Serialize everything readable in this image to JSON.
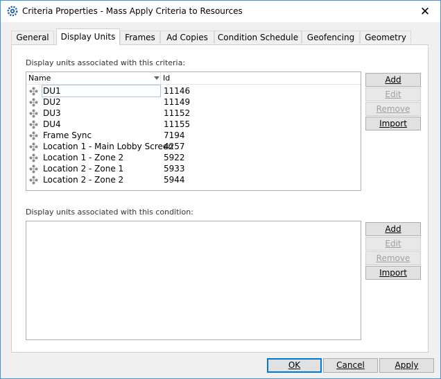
{
  "window": {
    "title": "Criteria Properties - Mass Apply Criteria to Resources",
    "close_glyph": "✕",
    "accent": "#1e5fb4"
  },
  "tabs": [
    {
      "label": "General"
    },
    {
      "label": "Display Units",
      "active": true
    },
    {
      "label": "Frames"
    },
    {
      "label": "Ad Copies"
    },
    {
      "label": "Condition Schedule"
    },
    {
      "label": "Geofencing"
    },
    {
      "label": "Geometry"
    }
  ],
  "criteria_section": {
    "label": "Display units associated with this criteria:",
    "columns": {
      "name": "Name",
      "id": "Id"
    },
    "rows": [
      {
        "name": "DU1",
        "id": "11146"
      },
      {
        "name": "DU2",
        "id": "11149"
      },
      {
        "name": "DU3",
        "id": "11152"
      },
      {
        "name": "DU4",
        "id": "11155"
      },
      {
        "name": "Frame Sync",
        "id": "7194"
      },
      {
        "name": "Location 1 - Main Lobby Screen",
        "id": "4257"
      },
      {
        "name": "Location 1 - Zone 2",
        "id": "5922"
      },
      {
        "name": "Location 2 - Zone 1",
        "id": "5933"
      },
      {
        "name": "Location 2 - Zone 2",
        "id": "5944"
      }
    ],
    "buttons": {
      "add": "Add",
      "edit": "Edit",
      "remove": "Remove",
      "import": "Import"
    }
  },
  "condition_section": {
    "label": "Display units associated with this condition:",
    "buttons": {
      "add": "Add",
      "edit": "Edit",
      "remove": "Remove",
      "import": "Import"
    }
  },
  "footer": {
    "ok": "OK",
    "cancel": "Cancel",
    "apply": "Apply"
  }
}
